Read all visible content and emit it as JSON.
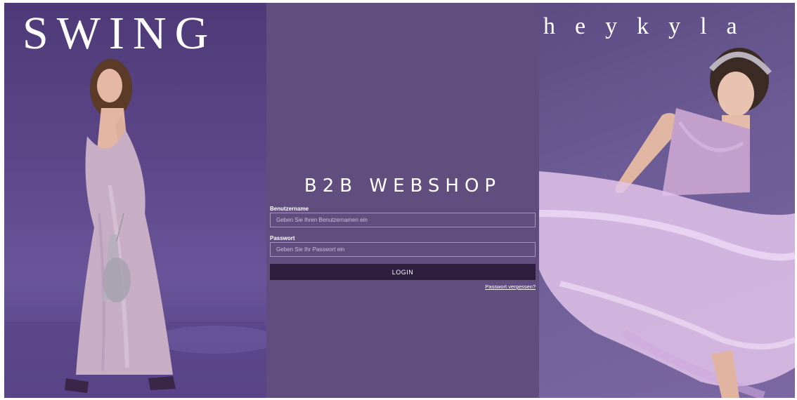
{
  "left_panel": {
    "brand": "SWING",
    "image": "model-in-satin-slip-dress-photo"
  },
  "login": {
    "title": "B2B WEBSHOP",
    "username_label": "Benutzername",
    "username_placeholder": "Geben Sie Ihren Benutzernamen ein",
    "username_value": "",
    "password_label": "Passwort",
    "password_placeholder": "Geben Sie Ihr Passwort ein",
    "password_value": "",
    "login_button": "LOGIN",
    "forgot_password": "Passwort vergessen?"
  },
  "right_panel": {
    "brand": "heykyla",
    "image": "model-in-tulle-ballgown-photo"
  },
  "colors": {
    "center_background": "#614e7f",
    "button_background": "#2f1f3f",
    "input_border": "#a398b7",
    "text": "#ffffff"
  }
}
